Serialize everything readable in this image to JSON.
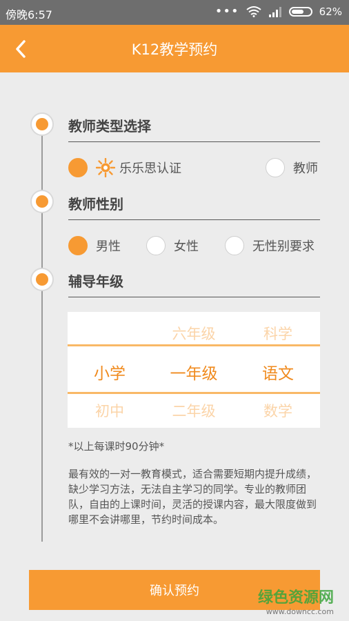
{
  "status": {
    "time": "傍晚6:57",
    "battery": "62%"
  },
  "app": {
    "title": "K12教学预约"
  },
  "sections": {
    "teacher_type": {
      "title": "教师类型选择",
      "options": [
        {
          "label": "乐乐思认证",
          "selected": true
        },
        {
          "label": "教师",
          "selected": false
        }
      ]
    },
    "gender": {
      "title": "教师性别",
      "options": [
        {
          "label": "男性",
          "selected": true
        },
        {
          "label": "女性",
          "selected": false
        },
        {
          "label": "无性别要求",
          "selected": false
        }
      ]
    },
    "grade": {
      "title": "辅导年级",
      "picker": {
        "col1": [
          "",
          "小学",
          "初中"
        ],
        "col2": [
          "六年级",
          "一年级",
          "二年级"
        ],
        "col3": [
          "科学",
          "语文",
          "数学"
        ]
      }
    }
  },
  "note": "*以上每课时90分钟*",
  "description": "最有效的一对一教育模式，适合需要短期内提升成绩，缺少学习方法，无法自主学习的同学。专业的教师团队，自由的上课时间，灵活的授课内容，最大限度做到哪里不会讲哪里，节约时间成本。",
  "confirm_label": "确认预约",
  "watermark": {
    "text": "绿色资源网",
    "url": "www.downcc.com"
  },
  "colors": {
    "accent": "#f79a33",
    "statusbar": "#6e6e6e"
  },
  "icons": {
    "back": "back-arrow-icon",
    "wifi": "wifi-icon",
    "signal": "signal-icon",
    "battery": "battery-icon",
    "certified": "sun-badge-icon"
  }
}
